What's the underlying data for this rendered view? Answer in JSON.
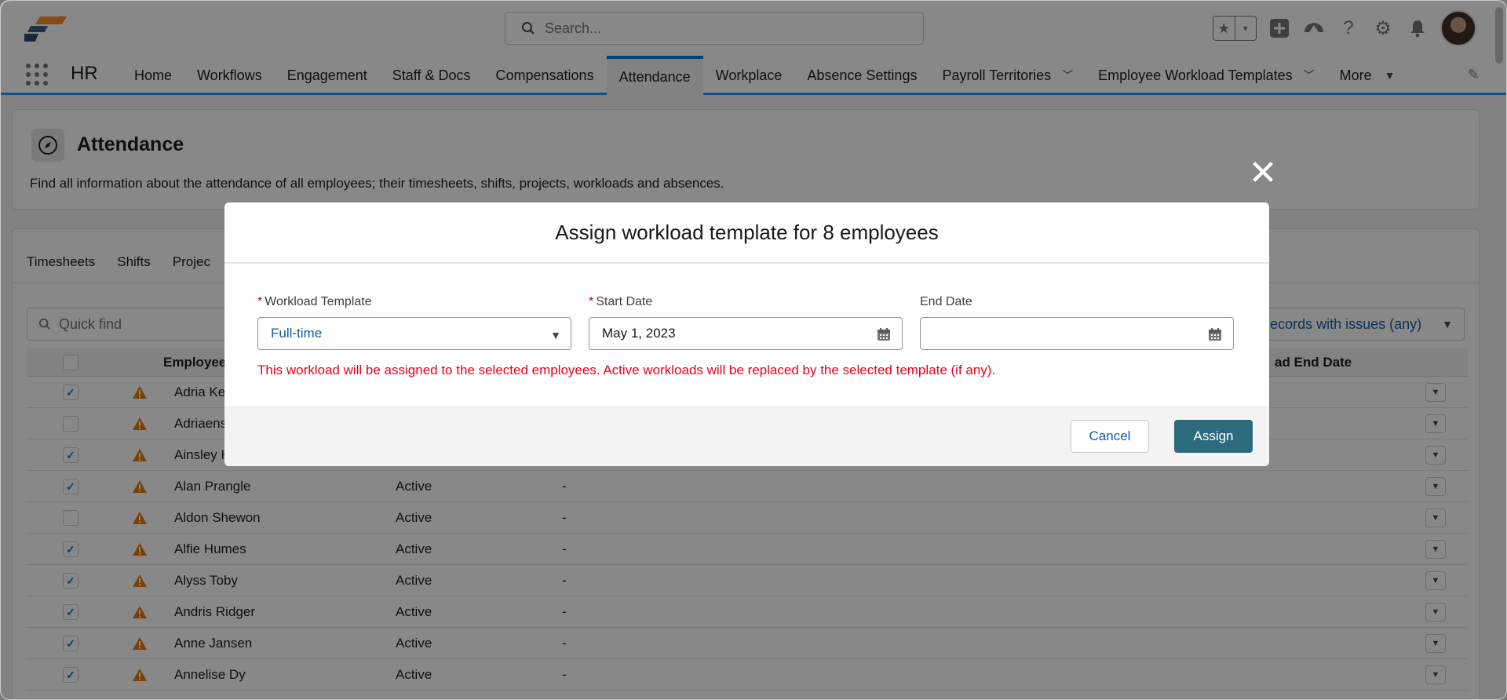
{
  "topbar": {
    "search_placeholder": "Search..."
  },
  "nav": {
    "app_name": "HR",
    "items": [
      {
        "label": "Home",
        "name": "nav-home"
      },
      {
        "label": "Workflows",
        "name": "nav-workflows"
      },
      {
        "label": "Engagement",
        "name": "nav-engagement"
      },
      {
        "label": "Staff & Docs",
        "name": "nav-staff-docs"
      },
      {
        "label": "Compensations",
        "name": "nav-compensations"
      },
      {
        "label": "Attendance",
        "name": "nav-attendance",
        "active": true
      },
      {
        "label": "Workplace",
        "name": "nav-workplace"
      },
      {
        "label": "Absence Settings",
        "name": "nav-absence-settings"
      },
      {
        "label": "Payroll Territories",
        "name": "nav-payroll-territories",
        "dropdown": true
      },
      {
        "label": "Employee Workload Templates",
        "name": "nav-employee-workload-templates",
        "dropdown": true
      },
      {
        "label": "More",
        "name": "nav-more",
        "more": true
      }
    ]
  },
  "page_header": {
    "title": "Attendance",
    "description": "Find all information about the attendance of all employees; their timesheets, shifts, projects, workloads and absences."
  },
  "list": {
    "tabs": [
      "Timesheets",
      "Shifts",
      "Projec"
    ],
    "quickfind_placeholder": "Quick find",
    "filter_label": "Records with issues (any)",
    "columns": {
      "employee": "Employee",
      "workload_end_date": "ad End Date"
    },
    "rows": [
      {
        "name": "Adria Ken",
        "checked": true,
        "status": "",
        "workload": ""
      },
      {
        "name": "Adriaens",
        "checked": false,
        "status": "",
        "workload": ""
      },
      {
        "name": "Ainsley H",
        "checked": true,
        "status": "",
        "workload": ""
      },
      {
        "name": "Alan Prangle",
        "checked": true,
        "status": "Active",
        "workload": "-"
      },
      {
        "name": "Aldon Shewon",
        "checked": false,
        "status": "Active",
        "workload": "-"
      },
      {
        "name": "Alfie Humes",
        "checked": true,
        "status": "Active",
        "workload": "-"
      },
      {
        "name": "Alyss Toby",
        "checked": true,
        "status": "Active",
        "workload": "-"
      },
      {
        "name": "Andris Ridger",
        "checked": true,
        "status": "Active",
        "workload": "-"
      },
      {
        "name": "Anne Jansen",
        "checked": true,
        "status": "Active",
        "workload": "-"
      },
      {
        "name": "Annelise Dy",
        "checked": true,
        "status": "Active",
        "workload": "-"
      }
    ]
  },
  "modal": {
    "title": "Assign workload template for 8 employees",
    "fields": {
      "workload_template": {
        "label": "Workload Template",
        "required": true,
        "value": "Full-time"
      },
      "start_date": {
        "label": "Start Date",
        "required": true,
        "value": "May 1, 2023"
      },
      "end_date": {
        "label": "End Date",
        "required": false,
        "value": ""
      }
    },
    "message": "This workload will be assigned to the selected employees. Active workloads will be replaced by the selected template (if any).",
    "cancel_label": "Cancel",
    "assign_label": "Assign"
  },
  "colors": {
    "brand_blue": "#0176d3",
    "assign_button": "#2e6a7e",
    "warning_icon": "#dd7a01",
    "error_text": "#ea001e"
  },
  "icons": {
    "logo": "app-logo",
    "close": "close-icon",
    "calendar": "calendar-icon",
    "warning": "warning-icon"
  }
}
